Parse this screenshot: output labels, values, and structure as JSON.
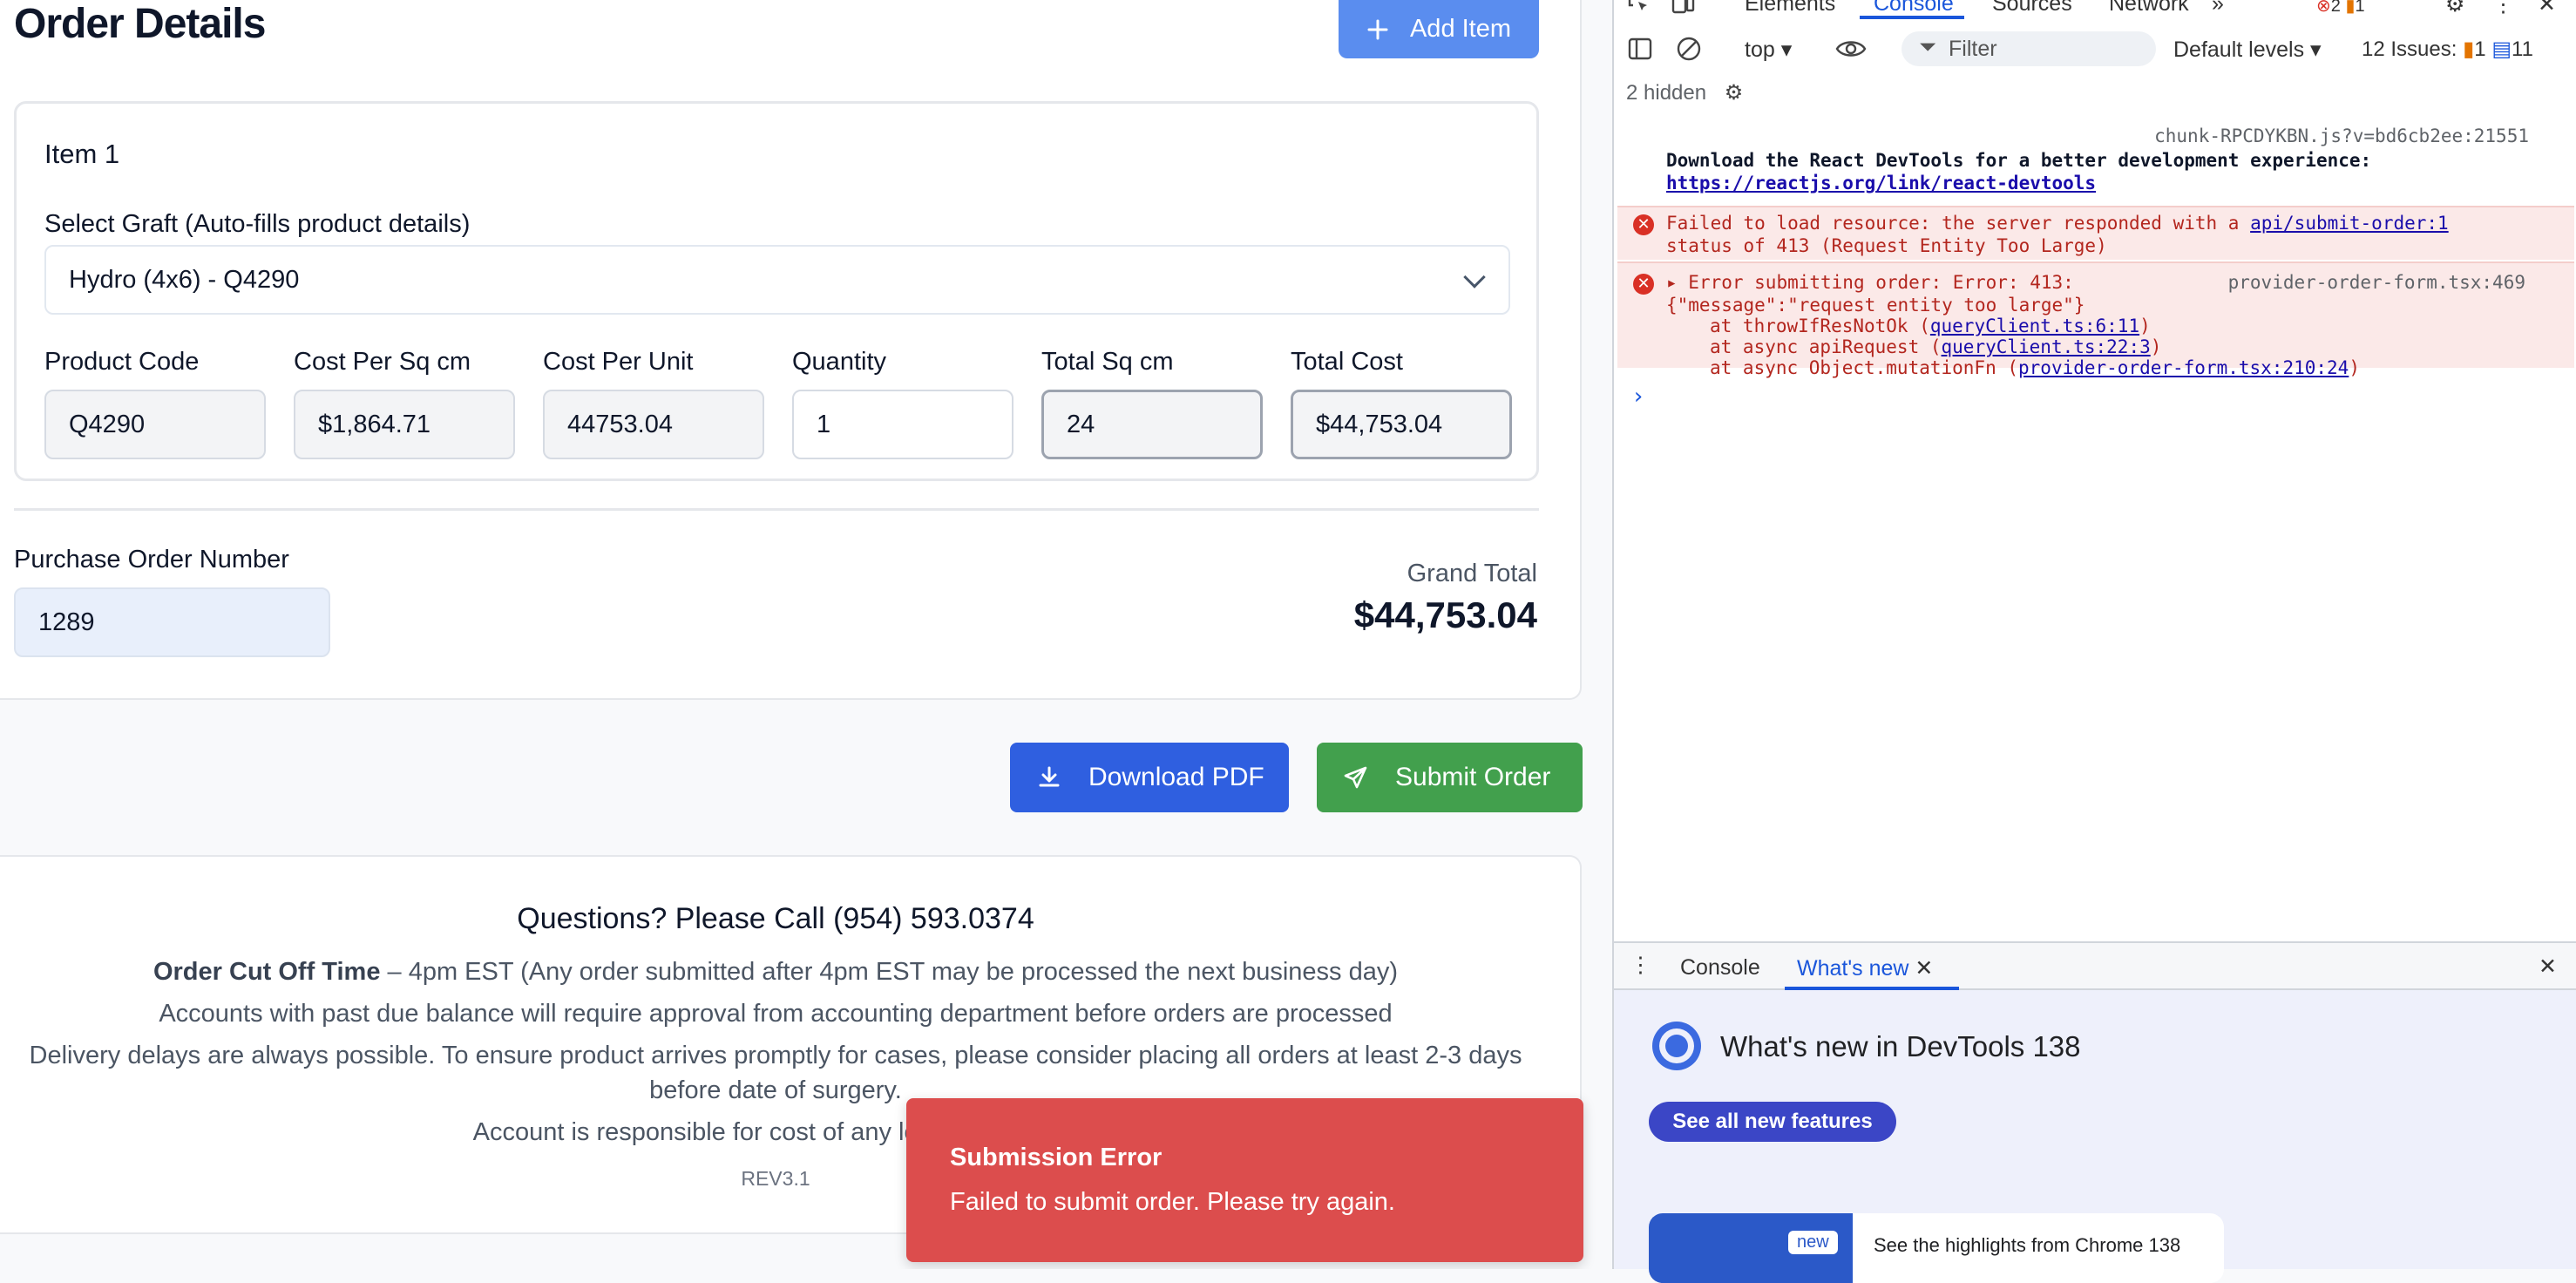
{
  "page": {
    "title": "Order Details",
    "add_item_label": "Add Item"
  },
  "item": {
    "title": "Item 1",
    "graft_label": "Select Graft (Auto-fills product details)",
    "graft_value": "Hydro (4x6) - Q4290",
    "fields": [
      {
        "label": "Product Code",
        "value": "Q4290"
      },
      {
        "label": "Cost Per Sq cm",
        "value": "$1,864.71"
      },
      {
        "label": "Cost Per Unit",
        "value": "44753.04"
      },
      {
        "label": "Quantity",
        "value": "1"
      },
      {
        "label": "Total Sq cm",
        "value": "24"
      },
      {
        "label": "Total Cost",
        "value": "$44,753.04"
      }
    ]
  },
  "po": {
    "label": "Purchase Order Number",
    "value": "1289"
  },
  "grand_total": {
    "label": "Grand Total",
    "value": "$44,753.04"
  },
  "actions": {
    "download_pdf": "Download PDF",
    "submit_order": "Submit Order"
  },
  "info": {
    "phone_line": "Questions? Please Call (954) 593.0374",
    "cutoff_bold": "Order Cut Off Time",
    "cutoff_rest": " – 4pm EST (Any order submitted after 4pm EST may be processed the next business day)",
    "line2": "Accounts with past due balance will require approval from accounting department before orders are processed",
    "line3": "Delivery delays are always possible. To ensure product arrives promptly for cases, please consider placing all orders at least 2-3 days before date of surgery.",
    "line4": "Account is responsible for cost of any lost product afte",
    "rev": "REV3.1"
  },
  "toast": {
    "title": "Submission Error",
    "message": "Failed to submit order. Please try again."
  },
  "devtools": {
    "tabs": [
      "Elements",
      "Console",
      "Sources",
      "Network"
    ],
    "active_tab": "Console",
    "error_count": "2",
    "warn_count": "1",
    "context": "top",
    "filter_placeholder": "Filter",
    "levels": "Default levels",
    "issues_label": "12 Issues:",
    "issues_warn": "1",
    "issues_info": "11",
    "hidden": "2 hidden",
    "messages": {
      "m1_src": "chunk-RPCDYKBN.js?v=bd6cb2ee:21551",
      "m1_text": "Download the React DevTools for a better development experience:",
      "m1_link": "https://reactjs.org/link/react-devtools",
      "m2_text": "Failed to load resource: the server responded with a",
      "m2_link": "api/submit-order:1",
      "m2_text2": "status of 413 (Request Entity Too Large)",
      "m3_text": "Error submitting order: Error: 413:",
      "m3_src": "provider-order-form.tsx:469",
      "m3_line2": "{\"message\":\"request entity too large\"}",
      "m3_line3_pre": "at throwIfResNotOk (",
      "m3_line3_link": "queryClient.ts:6:11",
      "m3_line4_pre": "at async apiRequest (",
      "m3_line4_link": "queryClient.ts:22:3",
      "m3_line5_pre": "at async Object.mutationFn (",
      "m3_line5_link": "provider-order-form.tsx:210:24",
      "close_paren": ")",
      "prompt": "›"
    },
    "drawer": {
      "tab_console": "Console",
      "tab_whats_new": "What's new",
      "title": "What's new in DevTools 138",
      "button": "See all new features",
      "badge": "new",
      "card_text": "See the highlights from Chrome 138"
    }
  }
}
